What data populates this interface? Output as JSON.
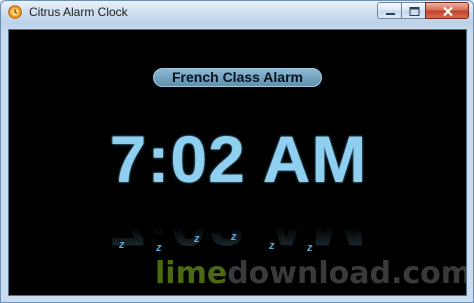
{
  "window": {
    "title": "Citrus Alarm Clock",
    "icon": "clock-icon",
    "controls": {
      "minimize": "minimize-icon",
      "maximize": "maximize-icon",
      "close": "close-icon"
    }
  },
  "alarm": {
    "label": "French Class Alarm",
    "time": "7:02 AM",
    "snooze_glyph": "z"
  },
  "watermark": {
    "part1": "lime",
    "part2": "download.com"
  },
  "colors": {
    "client_background": "#000000",
    "time_text": "#8fd0f1",
    "label_pill": "#6f9fbb",
    "close_button": "#c2432b"
  }
}
